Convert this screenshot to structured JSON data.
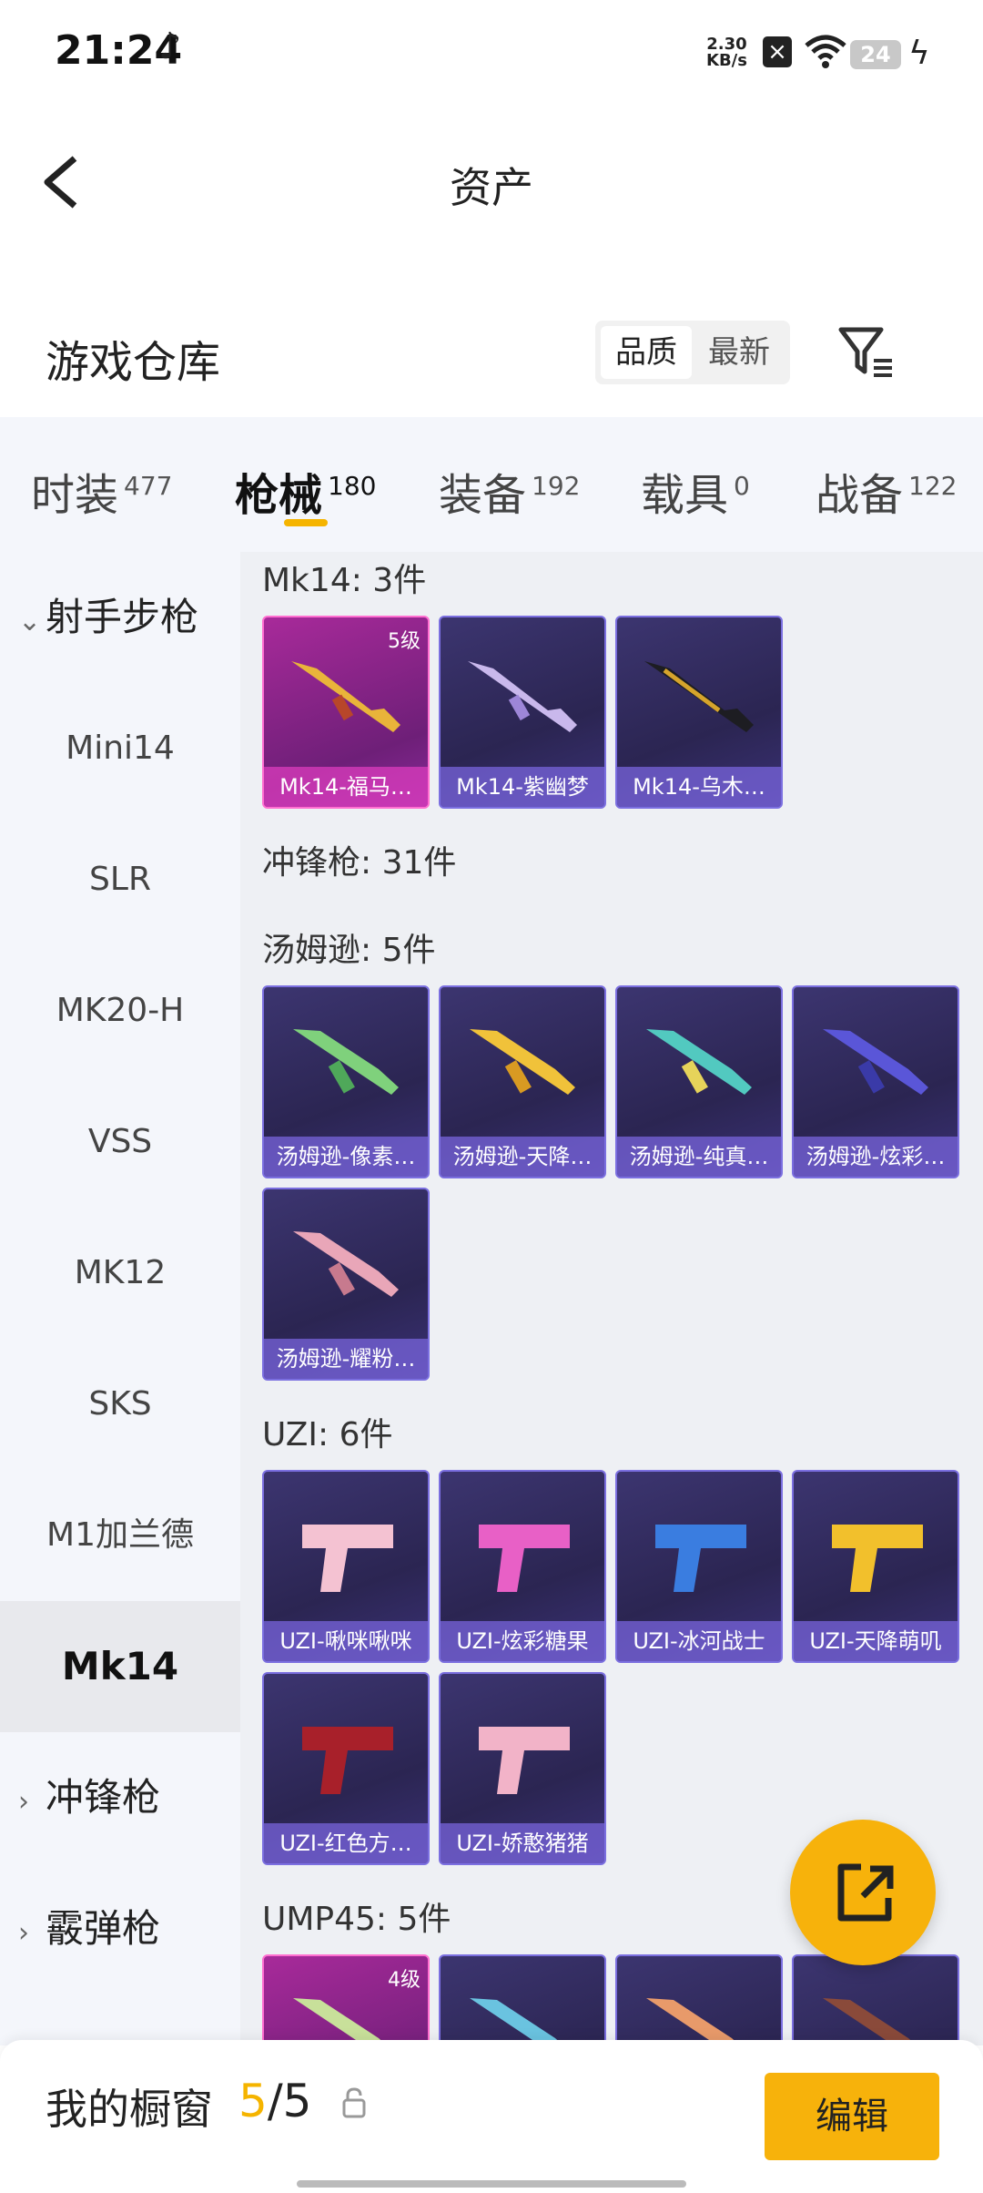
{
  "status_bar": {
    "time": "21:24",
    "net_speed_value": "2.30",
    "net_speed_unit": "KB/s",
    "battery": "24"
  },
  "header": {
    "title": "资产"
  },
  "section": {
    "title": "游戏仓库",
    "sort_options": [
      "品质",
      "最新"
    ],
    "sort_selected": "品质"
  },
  "tabs": [
    {
      "label": "时装",
      "count": "477"
    },
    {
      "label": "枪械",
      "count": "180",
      "active": true
    },
    {
      "label": "装备",
      "count": "192"
    },
    {
      "label": "载具",
      "count": "0"
    },
    {
      "label": "战备",
      "count": "122"
    }
  ],
  "sidebar": {
    "category_expanded": "射手步枪",
    "items": [
      "Mini14",
      "SLR",
      "MK20-H",
      "VSS",
      "MK12",
      "SKS",
      "M1加兰德",
      "Mk14"
    ],
    "selected": "Mk14",
    "categories_collapsed": [
      "冲锋枪",
      "霰弹枪"
    ]
  },
  "content": {
    "groups": [
      {
        "title": "Mk14: 3件",
        "items": [
          {
            "name": "Mk14-福马…",
            "level": "5级",
            "quality": "pink"
          },
          {
            "name": "Mk14-紫幽梦"
          },
          {
            "name": "Mk14-乌木…"
          }
        ]
      },
      {
        "title": "冲锋枪: 31件",
        "items": []
      },
      {
        "title": "汤姆逊: 5件",
        "items": [
          {
            "name": "汤姆逊-像素…"
          },
          {
            "name": "汤姆逊-天降…"
          },
          {
            "name": "汤姆逊-纯真…"
          },
          {
            "name": "汤姆逊-炫彩…"
          },
          {
            "name": "汤姆逊-耀粉…"
          }
        ]
      },
      {
        "title": "UZI: 6件",
        "items": [
          {
            "name": "UZI-啾咪啾咪"
          },
          {
            "name": "UZI-炫彩糖果"
          },
          {
            "name": "UZI-冰河战士"
          },
          {
            "name": "UZI-天降萌叽"
          },
          {
            "name": "UZI-红色方…"
          },
          {
            "name": "UZI-娇憨猪猪"
          }
        ]
      },
      {
        "title": "UMP45: 5件",
        "items": [
          {
            "name": "",
            "level": "4级",
            "quality": "pink"
          },
          {
            "name": ""
          },
          {
            "name": ""
          },
          {
            "name": ""
          }
        ]
      }
    ]
  },
  "bottom_bar": {
    "label": "我的橱窗",
    "count_current": "5",
    "count_total": "/5",
    "edit_label": "编辑"
  }
}
